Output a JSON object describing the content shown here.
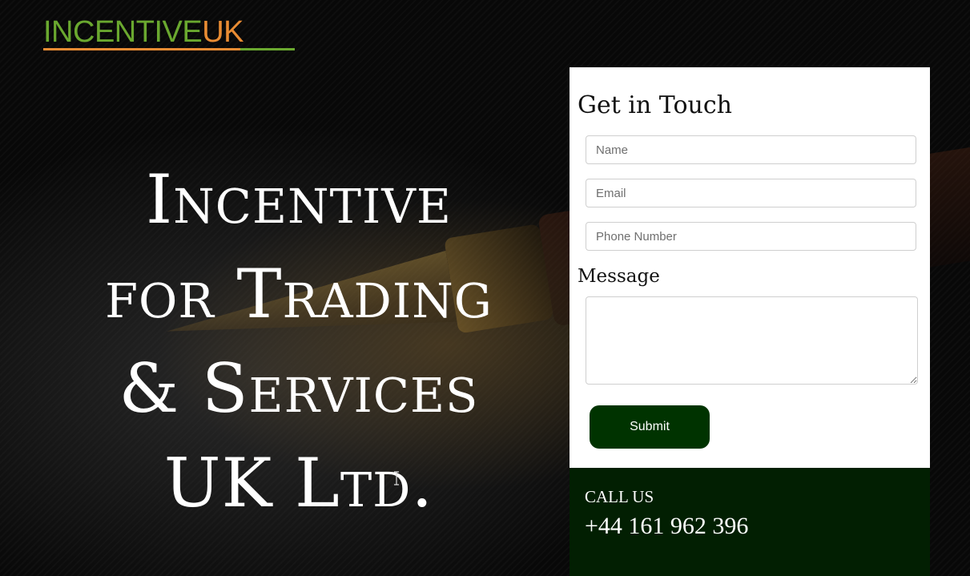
{
  "brand": {
    "logo_part_1": "INCENTIVE",
    "logo_part_2": "UK",
    "primary_color": "#6aa82f",
    "accent_color": "#e98c33"
  },
  "hero": {
    "line_1": "Incentive",
    "line_2": "for Trading",
    "line_3": "& Services",
    "line_4": "UK Ltd."
  },
  "contact_form": {
    "heading": "Get in Touch",
    "name_placeholder": "Name",
    "email_placeholder": "Email",
    "phone_placeholder": "Phone Number",
    "message_label": "Message",
    "submit_label": "Submit",
    "submit_color": "#003300"
  },
  "call": {
    "label": "CALL US",
    "number": "+44 161 962 396",
    "panel_color": "#021f02"
  }
}
